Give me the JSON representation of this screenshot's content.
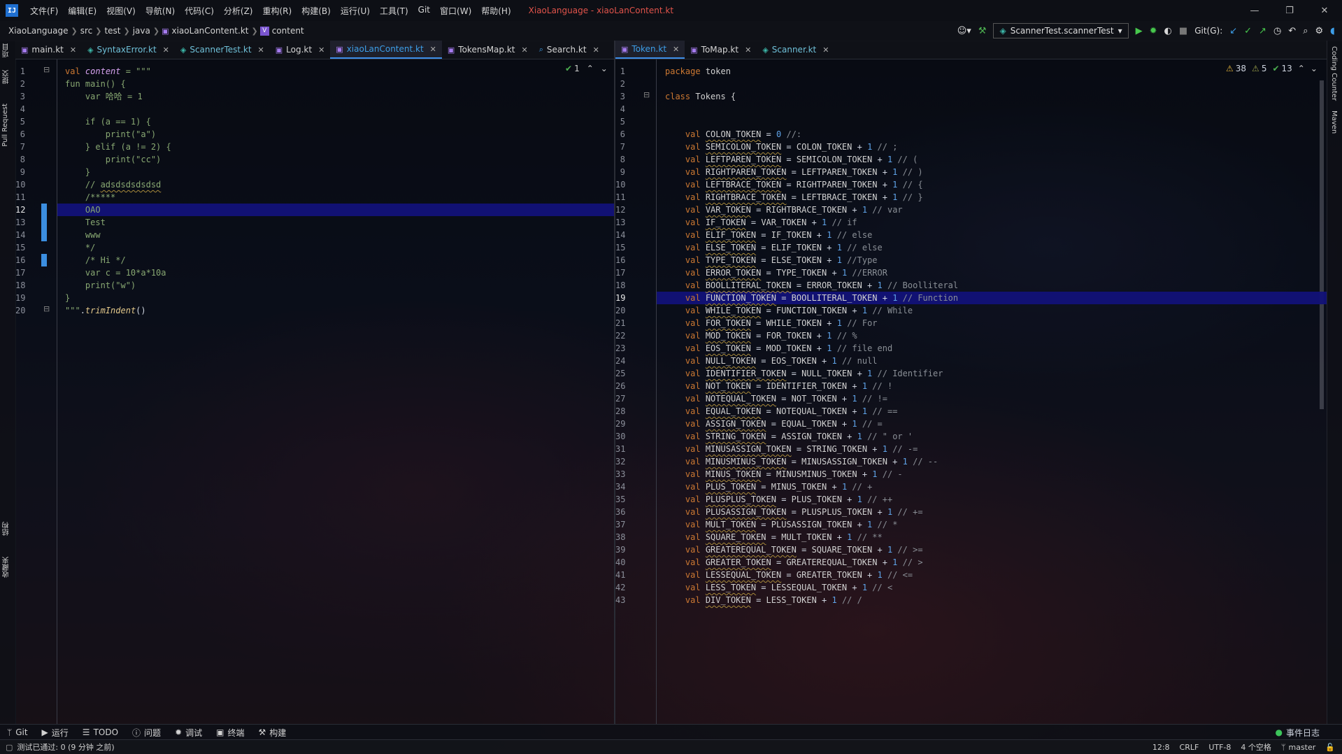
{
  "menubar": {
    "app_icon": "intellij-logo-icon",
    "items": [
      "文件(F)",
      "编辑(E)",
      "视图(V)",
      "导航(N)",
      "代码(C)",
      "分析(Z)",
      "重构(R)",
      "构建(B)",
      "运行(U)",
      "工具(T)",
      "Git",
      "窗口(W)",
      "帮助(H)"
    ],
    "window_title": "XiaoLanguage - xiaoLanContent.kt"
  },
  "navbar": {
    "breadcrumbs": [
      "XiaoLanguage",
      "src",
      "test",
      "java",
      "xiaoLanContent.kt",
      "content"
    ],
    "run_config": "ScannerTest.scannerTest",
    "git_label": "Git(G):"
  },
  "left_strip": {
    "items": [
      "项目",
      "提交",
      "Pull Request",
      "结构",
      "收藏夹"
    ]
  },
  "right_strip": {
    "items": [
      "Coding Counter",
      "Maven"
    ]
  },
  "left_pane": {
    "tabs": [
      {
        "label": "main.kt",
        "kind": "kt"
      },
      {
        "label": "SyntaxError.kt",
        "kind": "test"
      },
      {
        "label": "ScannerTest.kt",
        "kind": "test"
      },
      {
        "label": "Log.kt",
        "kind": "kt"
      },
      {
        "label": "xiaoLanContent.kt",
        "kind": "kt",
        "active": true
      },
      {
        "label": "TokensMap.kt",
        "kind": "kt"
      },
      {
        "label": "Search.kt",
        "kind": "search"
      }
    ],
    "inspection": {
      "ok_count": "1"
    },
    "current_line": 12,
    "lines": [
      "val content = \"\"\"",
      "fun main() {",
      "    var 哈哈 = 1",
      "",
      "    if (a == 1) {",
      "        print(\"a\")",
      "    } elif (a != 2) {",
      "        print(\"cc\")",
      "    }",
      "    // adsdsdsdsdsd",
      "    /*****",
      "    OAO",
      "    Test",
      "    www",
      "    */",
      "    /* Hi */",
      "    var c = 10*a*10a",
      "    print(\"w\")",
      "}",
      "\"\"\".trimIndent()"
    ]
  },
  "right_pane": {
    "tabs": [
      {
        "label": "Token.kt",
        "kind": "kt",
        "active": true
      },
      {
        "label": "ToMap.kt",
        "kind": "kt"
      },
      {
        "label": "Scanner.kt",
        "kind": "test"
      }
    ],
    "inspection": {
      "warnings": "38",
      "weak_warnings": "5",
      "ok_count": "13"
    },
    "current_line": 19,
    "header_lines": [
      "package token",
      "",
      "class Tokens {",
      "",
      ""
    ],
    "token_lines": [
      {
        "name": "COLON_TOKEN",
        "expr": "0",
        "comment": "//:"
      },
      {
        "name": "SEMICOLON_TOKEN",
        "prev": "COLON_TOKEN",
        "comment": "// ;"
      },
      {
        "name": "LEFTPAREN_TOKEN",
        "prev": "SEMICOLON_TOKEN",
        "comment": "// ("
      },
      {
        "name": "RIGHTPAREN_TOKEN",
        "prev": "LEFTPAREN_TOKEN",
        "comment": "// )"
      },
      {
        "name": "LEFTBRACE_TOKEN",
        "prev": "RIGHTPAREN_TOKEN",
        "comment": "// {"
      },
      {
        "name": "RIGHTBRACE_TOKEN",
        "prev": "LEFTBRACE_TOKEN",
        "comment": "// }"
      },
      {
        "name": "VAR_TOKEN",
        "prev": "RIGHTBRACE_TOKEN",
        "comment": "// var"
      },
      {
        "name": "IF_TOKEN",
        "prev": "VAR_TOKEN",
        "comment": "// if"
      },
      {
        "name": "ELIF_TOKEN",
        "prev": "IF_TOKEN",
        "comment": "// else"
      },
      {
        "name": "ELSE_TOKEN",
        "prev": "ELIF_TOKEN",
        "comment": "// else"
      },
      {
        "name": "TYPE_TOKEN",
        "prev": "ELSE_TOKEN",
        "comment": "//Type"
      },
      {
        "name": "ERROR_TOKEN",
        "prev": "TYPE_TOKEN",
        "comment": "//ERROR"
      },
      {
        "name": "BOOLLITERAL_TOKEN",
        "prev": "ERROR_TOKEN",
        "comment": "// Boolliteral"
      },
      {
        "name": "FUNCTION_TOKEN",
        "prev": "BOOLLITERAL_TOKEN",
        "comment": "// Function"
      },
      {
        "name": "WHILE_TOKEN",
        "prev": "FUNCTION_TOKEN",
        "comment": "// While"
      },
      {
        "name": "FOR_TOKEN",
        "prev": "WHILE_TOKEN",
        "comment": "// For"
      },
      {
        "name": "MOD_TOKEN",
        "prev": "FOR_TOKEN",
        "comment": "// %"
      },
      {
        "name": "EOS_TOKEN",
        "prev": "MOD_TOKEN",
        "comment": "// file end"
      },
      {
        "name": "NULL_TOKEN",
        "prev": "EOS_TOKEN",
        "comment": "// null"
      },
      {
        "name": "IDENTIFIER_TOKEN",
        "prev": "NULL_TOKEN",
        "comment": "// Identifier"
      },
      {
        "name": "NOT_TOKEN",
        "prev": "IDENTIFIER_TOKEN",
        "comment": "// !"
      },
      {
        "name": "NOTEQUAL_TOKEN",
        "prev": "NOT_TOKEN",
        "comment": "// !="
      },
      {
        "name": "EQUAL_TOKEN",
        "prev": "NOTEQUAL_TOKEN",
        "comment": "// =="
      },
      {
        "name": "ASSIGN_TOKEN",
        "prev": "EQUAL_TOKEN",
        "comment": "// ="
      },
      {
        "name": "STRING_TOKEN",
        "prev": "ASSIGN_TOKEN",
        "comment": "// \" or '"
      },
      {
        "name": "MINUSASSIGN_TOKEN",
        "prev": "STRING_TOKEN",
        "comment": "// -="
      },
      {
        "name": "MINUSMINUS_TOKEN",
        "prev": "MINUSASSIGN_TOKEN",
        "comment": "// --"
      },
      {
        "name": "MINUS_TOKEN",
        "prev": "MINUSMINUS_TOKEN",
        "comment": "// -"
      },
      {
        "name": "PLUS_TOKEN",
        "prev": "MINUS_TOKEN",
        "comment": "// +"
      },
      {
        "name": "PLUSPLUS_TOKEN",
        "prev": "PLUS_TOKEN",
        "comment": "// ++"
      },
      {
        "name": "PLUSASSIGN_TOKEN",
        "prev": "PLUSPLUS_TOKEN",
        "comment": "// +="
      },
      {
        "name": "MULT_TOKEN",
        "prev": "PLUSASSIGN_TOKEN",
        "comment": "// *"
      },
      {
        "name": "SQUARE_TOKEN",
        "prev": "MULT_TOKEN",
        "comment": "// **"
      },
      {
        "name": "GREATEREQUAL_TOKEN",
        "prev": "SQUARE_TOKEN",
        "comment": "// >="
      },
      {
        "name": "GREATER_TOKEN",
        "prev": "GREATEREQUAL_TOKEN",
        "comment": "// >"
      },
      {
        "name": "LESSEQUAL_TOKEN",
        "prev": "GREATER_TOKEN",
        "comment": "// <="
      },
      {
        "name": "LESS_TOKEN",
        "prev": "LESSEQUAL_TOKEN",
        "comment": "// <"
      },
      {
        "name": "DIV_TOKEN",
        "prev": "LESS_TOKEN",
        "comment": "// /"
      }
    ]
  },
  "toolwindows": [
    {
      "label": "Git",
      "icon": "git-icon"
    },
    {
      "label": "运行",
      "icon": "run-icon"
    },
    {
      "label": "TODO",
      "icon": "todo-icon"
    },
    {
      "label": "问题",
      "icon": "problems-icon"
    },
    {
      "label": "调试",
      "icon": "debug-icon"
    },
    {
      "label": "终端",
      "icon": "terminal-icon"
    },
    {
      "label": "构建",
      "icon": "build-icon"
    }
  ],
  "event_log": "事件日志",
  "statusbar": {
    "message": "测试已通过: 0 (9 分钟 之前)",
    "position": "12:8",
    "line_sep": "CRLF",
    "encoding": "UTF-8",
    "indent": "4 个空格",
    "branch": "master"
  },
  "colors": {
    "accent": "#3d8ee8",
    "highlight": "#12127a",
    "keyword": "#cc7832",
    "number": "#5fa3e8"
  }
}
